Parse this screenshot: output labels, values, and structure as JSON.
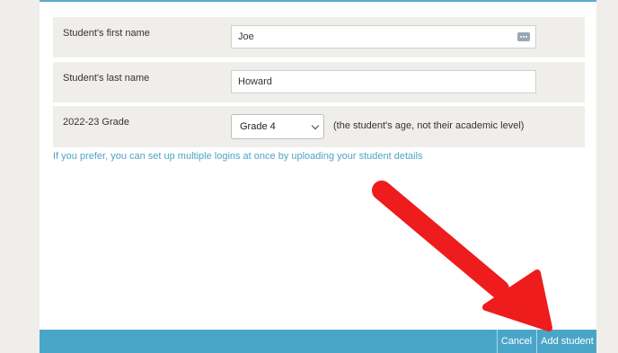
{
  "form": {
    "first_name": {
      "label": "Student's first name",
      "value": "Joe"
    },
    "last_name": {
      "label": "Student's last name",
      "value": "Howard"
    },
    "grade": {
      "label": "2022-23 Grade",
      "selected": "Grade 4",
      "hint": "(the student's age, not their academic level)"
    },
    "upload_link": "If you prefer, you can set up multiple logins at once by uploading your student details"
  },
  "footer": {
    "cancel_label": "Cancel",
    "add_label": "Add student"
  },
  "colors": {
    "accent": "#4aa6c9",
    "link": "#4fa3c6",
    "annotation_arrow": "#ee1c1c"
  }
}
